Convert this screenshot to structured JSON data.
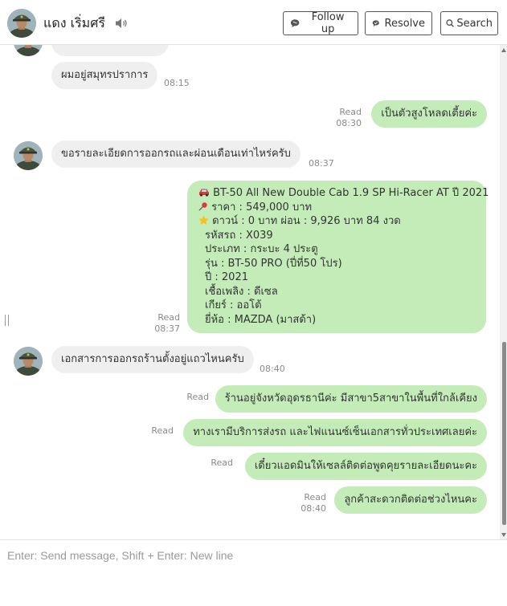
{
  "header": {
    "contact_name": "แดง เริ่มศรี",
    "follow_up_label": "Follow up",
    "resolve_label": "Resolve",
    "search_label": "Search"
  },
  "messages": {
    "m1": {
      "text": "ผมอยู่สมุทรปราการ",
      "time": "08:15"
    },
    "m2": {
      "text": "เป็นตัวสูงโหลดเตี้ยค่ะ",
      "status": "Read",
      "time": "08:30"
    },
    "m3": {
      "text": "ขอรายละเอียดการออกรถและผ่อนเดือนเท่าไหร่ครับ",
      "time": "08:37"
    },
    "card": {
      "status": "Read",
      "time": "08:37",
      "title": "BT-50 All New Double Cab 1.9 SP Hi-Racer AT ปี 2021",
      "price": "ราคา : 549,000 บาท",
      "down": "ดาวน์ : 0 บาท ผ่อน : 9,926 บาท 84 งวด",
      "code": "รหัสรถ : X039",
      "type": "ประเภท : กระบะ 4 ประตู",
      "model": "รุ่น : BT-50 PRO (ปี่ที่50 โปร)",
      "year": "ปี : 2021",
      "fuel": "เชื้อเพลิง : ดีเซล",
      "gear": "เกียร์ : ออโต้",
      "brand": "ยี่ห้อ : MAZDA (มาสด้า)"
    },
    "m5": {
      "text": "เอกสารการออกรถร้านตั้งอยู่แถวไหนครับ",
      "time": "08:40"
    },
    "m6": {
      "text": "ร้านอยู่จังหวัดอุดรธานีค่ะ มีสาขา5สาขาในพื้นที่ใกล้เคียง",
      "status": "Read"
    },
    "m7": {
      "text": "ทางเรามีบริการส่งรถ และไฟแนนซ์เซ็นเอกสารทั่วประเทศเลยค่ะ",
      "status": "Read"
    },
    "m8": {
      "text": "เดี๋ยวแอดมินให้เซลล์ติดต่อพูดคุยรายละเอียดนะคะ",
      "status": "Read"
    },
    "m9": {
      "text": "ลูกค้าสะดวกติดต่อช่วงไหนคะ",
      "status": "Read",
      "time": "08:40"
    }
  },
  "composer": {
    "placeholder": "Enter: Send message, Shift + Enter: New line"
  },
  "icons": {
    "speaker": "speaker-icon",
    "follow_up": "chat-bubble-icon",
    "resolve": "check-bubble-icon",
    "search": "search-icon",
    "car": "car-emoji-icon",
    "pin": "pushpin-emoji-icon",
    "star": "star-emoji-icon"
  },
  "colors": {
    "outgoing_bubble": "#c4ecb9",
    "incoming_bubble": "#efefef",
    "timestamp": "#8a8a8a"
  }
}
